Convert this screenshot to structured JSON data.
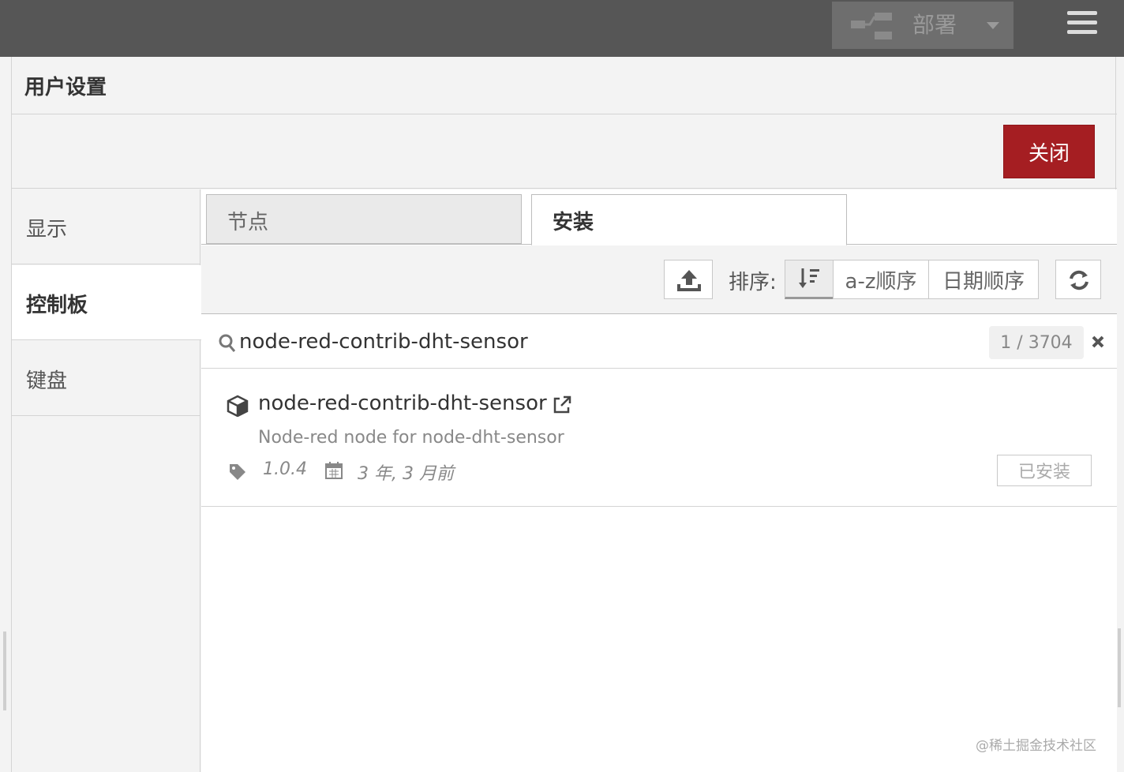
{
  "topbar": {
    "deploy_label": "部署",
    "icons": {
      "deploy": "deploy-flow-icon",
      "caret": "caret-down-icon",
      "menu": "hamburger-menu-icon"
    }
  },
  "dialog": {
    "title": "用户设置",
    "close_label": "关闭",
    "accent_color": "#a51e22"
  },
  "sidebar": {
    "items": [
      {
        "label": "显示",
        "active": false
      },
      {
        "label": "控制板",
        "active": true
      },
      {
        "label": "键盘",
        "active": false
      }
    ]
  },
  "tabs": [
    {
      "label": "节点",
      "active": false
    },
    {
      "label": "安装",
      "active": true
    }
  ],
  "sort": {
    "label": "排序:",
    "options": [
      "a-z顺序",
      "日期顺序"
    ],
    "selected_icon": "sort-amount-icon"
  },
  "search": {
    "value": "node-red-contrib-dht-sensor",
    "count": "1 / 3704"
  },
  "package": {
    "name": "node-red-contrib-dht-sensor",
    "description": "Node-red node for node-dht-sensor",
    "version": "1.0.4",
    "updated": "3 年, 3 月前",
    "status_label": "已安装"
  },
  "watermark": "@稀土掘金技术社区"
}
